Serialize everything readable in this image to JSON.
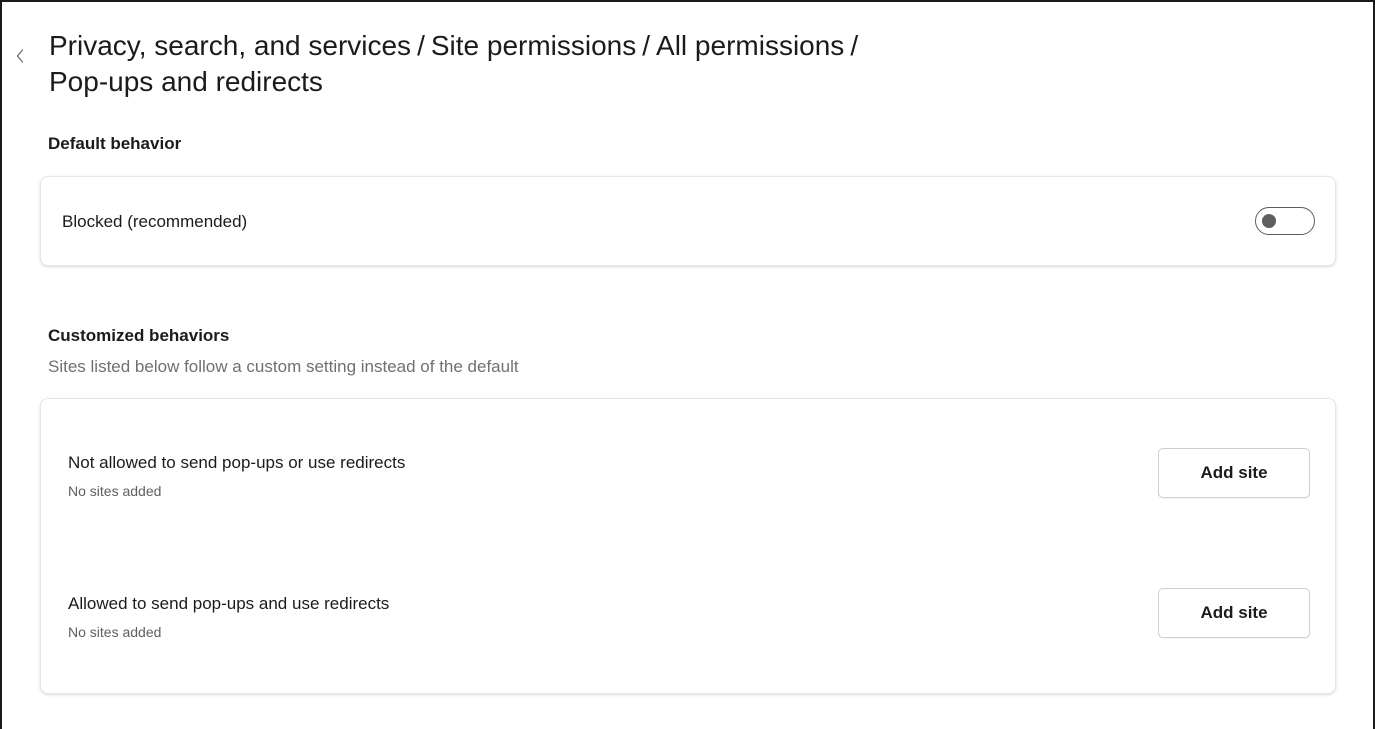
{
  "breadcrumb": {
    "item1": "Privacy, search, and services",
    "item2": "Site permissions",
    "item3": "All permissions",
    "current": "Pop-ups and redirects",
    "separator": "/"
  },
  "default_behavior": {
    "heading": "Default behavior",
    "label": "Blocked (recommended)",
    "toggle_on": false
  },
  "customized_behaviors": {
    "heading": "Customized behaviors",
    "description": "Sites listed below follow a custom setting instead of the default",
    "blocked": {
      "title": "Not allowed to send pop-ups or use redirects",
      "status": "No sites added",
      "button": "Add site"
    },
    "allowed": {
      "title": "Allowed to send pop-ups and use redirects",
      "status": "No sites added",
      "button": "Add site"
    }
  },
  "icons": {
    "back": "chevron-left-icon"
  },
  "colors": {
    "text": "#1b1b1b",
    "secondary_text": "#707070",
    "toggle_off": "#5e5e5e",
    "card_border": "#e6e6e6"
  }
}
